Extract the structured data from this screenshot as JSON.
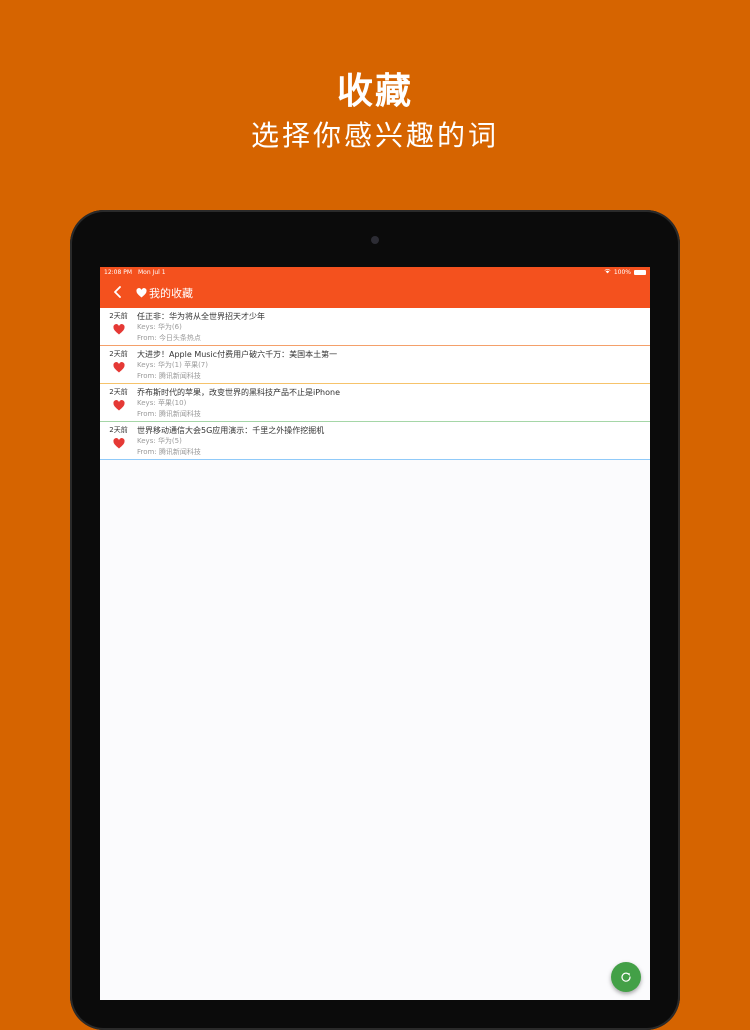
{
  "promo": {
    "title": "收藏",
    "subtitle": "选择你感兴趣的词"
  },
  "status_bar": {
    "time": "12:08 PM",
    "date": "Mon Jul 1",
    "battery": "100%"
  },
  "app_bar": {
    "title": "我的收藏",
    "color": "#F4511E",
    "back_icon": "chevron-left-icon",
    "title_icon": "heart-icon"
  },
  "items": [
    {
      "time": "2天前",
      "title": "任正非：华为将从全世界招天才少年",
      "keys_label": "Keys:",
      "keys": "华为(6)",
      "from_label": "From:",
      "source": "今日头条热点",
      "divider_color": "#F4A06A"
    },
    {
      "time": "2天前",
      "title": "大进步！Apple Music付费用户破六千万：美国本土第一",
      "keys_label": "Keys:",
      "keys": "华为(1) 苹果(7)",
      "from_label": "From:",
      "source": "腾讯新闻科技",
      "divider_color": "#F6C36B"
    },
    {
      "time": "2天前",
      "title": "乔布斯时代的苹果，改变世界的黑科技产品不止是iPhone",
      "keys_label": "Keys:",
      "keys": "苹果(10)",
      "from_label": "From:",
      "source": "腾讯新闻科技",
      "divider_color": "#A5D6A7"
    },
    {
      "time": "2天前",
      "title": "世界移动通信大会5G应用演示：千里之外操作挖掘机",
      "keys_label": "Keys:",
      "keys": "华为(5)",
      "from_label": "From:",
      "source": "腾讯新闻科技",
      "divider_color": "#90CAF9"
    }
  ],
  "favorite_color": "#E53935",
  "fab": {
    "icon": "refresh-icon",
    "color": "#43A047"
  }
}
